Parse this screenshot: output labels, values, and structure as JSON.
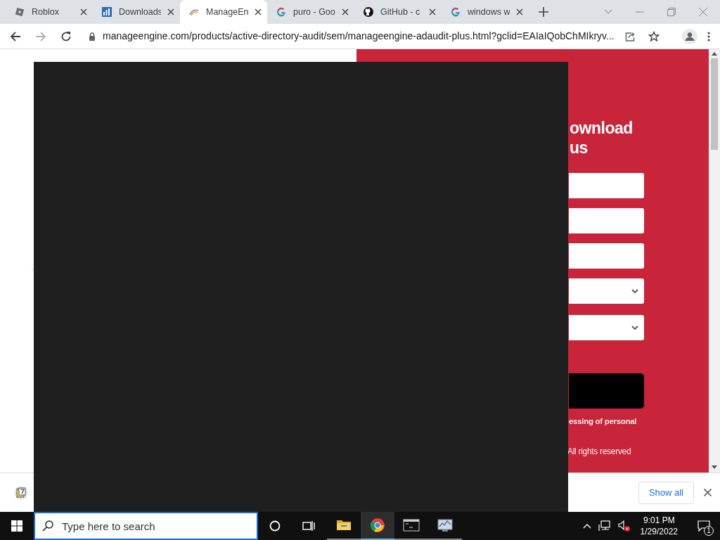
{
  "tabs": [
    {
      "title": "Roblox",
      "kind": "roblox",
      "selected": false
    },
    {
      "title": "Downloads",
      "kind": "chart",
      "selected": false
    },
    {
      "title": "ManageEn",
      "kind": "arc",
      "selected": true
    },
    {
      "title": "puro - Goo",
      "kind": "google",
      "selected": false
    },
    {
      "title": "GitHub - c",
      "kind": "github",
      "selected": false
    },
    {
      "title": "windows w",
      "kind": "google",
      "selected": false
    }
  ],
  "address_bar": {
    "url": "manageengine.com/products/active-directory-audit/sem/manageengine-adaudit-plus.html?gclid=EAIaIQobChMIkryv..."
  },
  "page": {
    "heading_lines": [
      "ownload",
      "us"
    ],
    "fields": [
      {
        "kind": "text"
      },
      {
        "kind": "text"
      },
      {
        "kind": "text"
      },
      {
        "kind": "select"
      },
      {
        "kind": "select"
      }
    ],
    "consent_text": "essing of personal",
    "footer_text": "All rights reserved"
  },
  "download_bar": {
    "show_all": "Show all"
  },
  "taskbar": {
    "search_placeholder": "Type here to search",
    "apps": [
      {
        "kind": "folder",
        "active": false
      },
      {
        "kind": "chrome",
        "active": true
      },
      {
        "kind": "console",
        "active": false
      },
      {
        "kind": "monitor",
        "active": false
      }
    ],
    "time": "9:01 PM",
    "date": "1/29/2022",
    "notifications": "1"
  }
}
